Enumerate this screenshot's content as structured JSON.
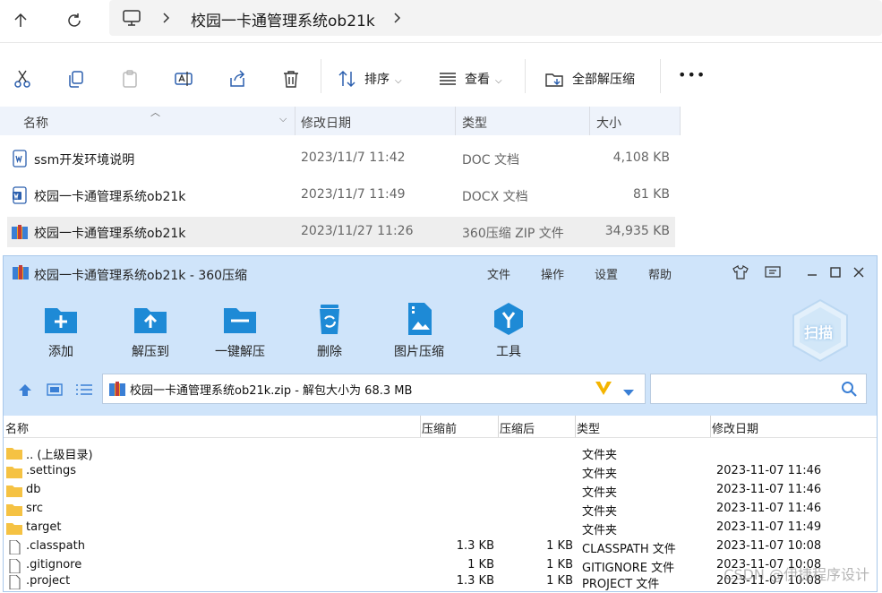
{
  "explorer": {
    "breadcrumb": "校园一卡通管理系统ob21k",
    "commands": {
      "sort": "排序",
      "view": "查看",
      "extract_all": "全部解压缩",
      "more": "•••"
    },
    "columns": {
      "name": "名称",
      "modified": "修改日期",
      "type": "类型",
      "size": "大小"
    },
    "files": [
      {
        "name": "ssm开发环境说明",
        "modified": "2023/11/7 11:42",
        "type": "DOC 文档",
        "size": "4,108 KB"
      },
      {
        "name": "校园一卡通管理系统ob21k",
        "modified": "2023/11/7 11:49",
        "type": "DOCX 文档",
        "size": "81 KB"
      },
      {
        "name": "校园一卡通管理系统ob21k",
        "modified": "2023/11/27 11:26",
        "type": "360压缩 ZIP 文件",
        "size": "34,935 KB"
      }
    ]
  },
  "zipwin": {
    "title": "校园一卡通管理系统ob21k - 360压缩",
    "menu": {
      "file": "文件",
      "operate": "操作",
      "settings": "设置",
      "help": "帮助"
    },
    "tools": {
      "add": "添加",
      "extract_to": "解压到",
      "one_click": "一键解压",
      "delete": "删除",
      "image_compress": "图片压缩",
      "tools": "工具"
    },
    "scan": "扫描",
    "path": "校园一卡通管理系统ob21k.zip - 解包大小为 68.3 MB",
    "columns": {
      "name": "名称",
      "before": "压缩前",
      "after": "压缩后",
      "type": "类型",
      "modified": "修改日期"
    },
    "rows": [
      {
        "name": ".. (上级目录)",
        "before": "",
        "after": "",
        "type": "文件夹",
        "modified": ""
      },
      {
        "name": ".settings",
        "before": "",
        "after": "",
        "type": "文件夹",
        "modified": "2023-11-07 11:46"
      },
      {
        "name": "db",
        "before": "",
        "after": "",
        "type": "文件夹",
        "modified": "2023-11-07 11:46"
      },
      {
        "name": "src",
        "before": "",
        "after": "",
        "type": "文件夹",
        "modified": "2023-11-07 11:46"
      },
      {
        "name": "target",
        "before": "",
        "after": "",
        "type": "文件夹",
        "modified": "2023-11-07 11:49"
      },
      {
        "name": ".classpath",
        "before": "1.3 KB",
        "after": "1 KB",
        "type": "CLASSPATH 文件",
        "modified": "2023-11-07 10:08"
      },
      {
        "name": ".gitignore",
        "before": "1 KB",
        "after": "1 KB",
        "type": "GITIGNORE 文件",
        "modified": "2023-11-07 10:08"
      },
      {
        "name": ".project",
        "before": "1.3 KB",
        "after": "1 KB",
        "type": "PROJECT 文件",
        "modified": "2023-11-07 10:08"
      }
    ]
  },
  "watermark": "CSDN @伊捷程序设计"
}
